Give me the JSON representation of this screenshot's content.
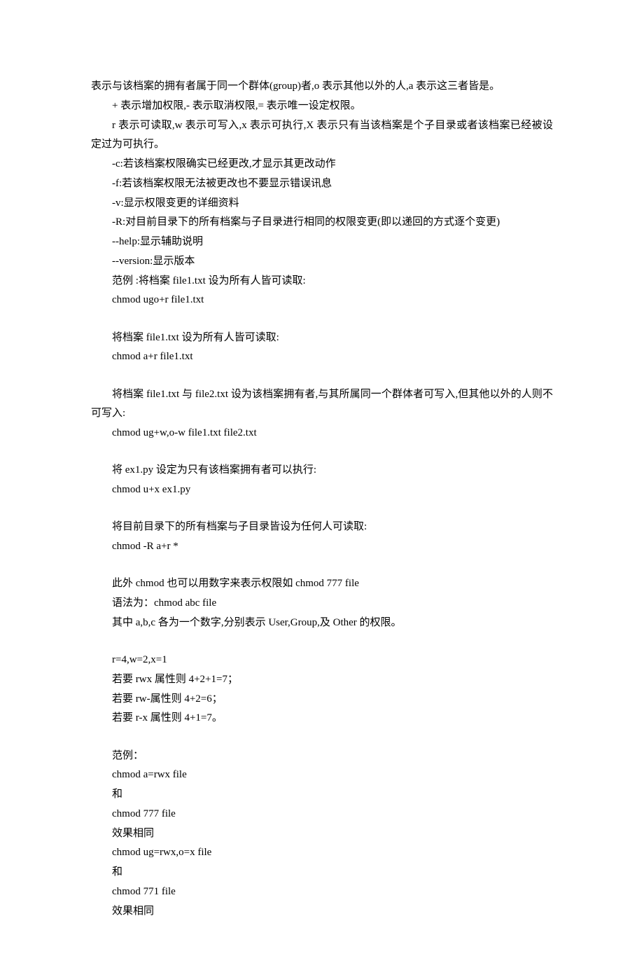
{
  "lines": {
    "l1": "表示与该档案的拥有者属于同一个群体(group)者,o 表示其他以外的人,a 表示这三者皆是。",
    "l2": "+ 表示增加权限,- 表示取消权限,= 表示唯一设定权限。",
    "l3": "r 表示可读取,w 表示可写入,x 表示可执行,X 表示只有当该档案是个子目录或者该档案已经被设定过为可执行。",
    "l4": "-c:若该档案权限确实已经更改,才显示其更改动作",
    "l5": "-f:若该档案权限无法被更改也不要显示错误讯息",
    "l6": "-v:显示权限变更的详细资料",
    "l7": "-R:对目前目录下的所有档案与子目录进行相同的权限变更(即以递回的方式逐个变更)",
    "l8": "--help:显示辅助说明",
    "l9": "--version:显示版本",
    "l10": "范例 :将档案 file1.txt 设为所有人皆可读取:",
    "l11": "chmod ugo+r file1.txt",
    "l12": "将档案 file1.txt 设为所有人皆可读取:",
    "l13": "chmod a+r file1.txt",
    "l14": "将档案 file1.txt 与 file2.txt 设为该档案拥有者,与其所属同一个群体者可写入,但其他以外的人则不可写入:",
    "l15": "chmod ug+w,o-w file1.txt file2.txt",
    "l16": "将 ex1.py 设定为只有该档案拥有者可以执行:",
    "l17": "chmod u+x ex1.py",
    "l18": "将目前目录下的所有档案与子目录皆设为任何人可读取:",
    "l19": "chmod -R a+r *",
    "l20": "此外 chmod 也可以用数字来表示权限如 chmod 777 file",
    "l21": "语法为：chmod abc file",
    "l22": "其中 a,b,c 各为一个数字,分别表示 User,Group,及 Other 的权限。",
    "l23": "r=4,w=2,x=1",
    "l24": "若要 rwx 属性则 4+2+1=7；",
    "l25": "若要 rw-属性则 4+2=6；",
    "l26": "若要 r-x 属性则 4+1=7。",
    "l27": "范例：",
    "l28": "chmod a=rwx file",
    "l29": "和",
    "l30": "chmod 777 file",
    "l31": "效果相同",
    "l32": "chmod ug=rwx,o=x file",
    "l33": "和",
    "l34": "chmod 771 file",
    "l35": "效果相同"
  }
}
